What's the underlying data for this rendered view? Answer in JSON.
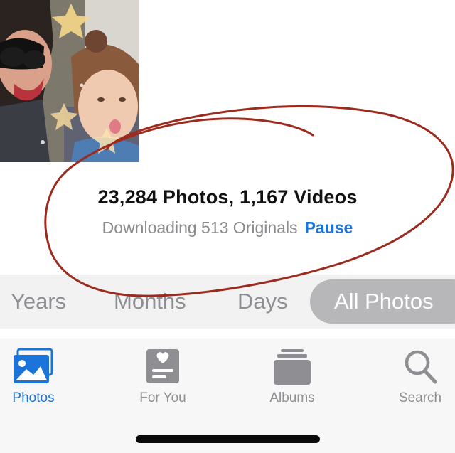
{
  "library": {
    "counts": "23,284 Photos, 1,167 Videos",
    "download_status": "Downloading 513 Originals",
    "pause_label": "Pause"
  },
  "time_scale": {
    "options": [
      "Years",
      "Months",
      "Days",
      "All Photos"
    ],
    "selected": "All Photos"
  },
  "tab_bar": {
    "items": [
      {
        "label": "Photos",
        "icon": "photos-icon",
        "active": true
      },
      {
        "label": "For You",
        "icon": "for-you-icon",
        "active": false
      },
      {
        "label": "Albums",
        "icon": "albums-icon",
        "active": false
      },
      {
        "label": "Search",
        "icon": "search-icon",
        "active": false
      }
    ]
  },
  "colors": {
    "accent": "#1a74d9",
    "inactive": "#8e8e93",
    "annotation": "#9c2b1e"
  }
}
